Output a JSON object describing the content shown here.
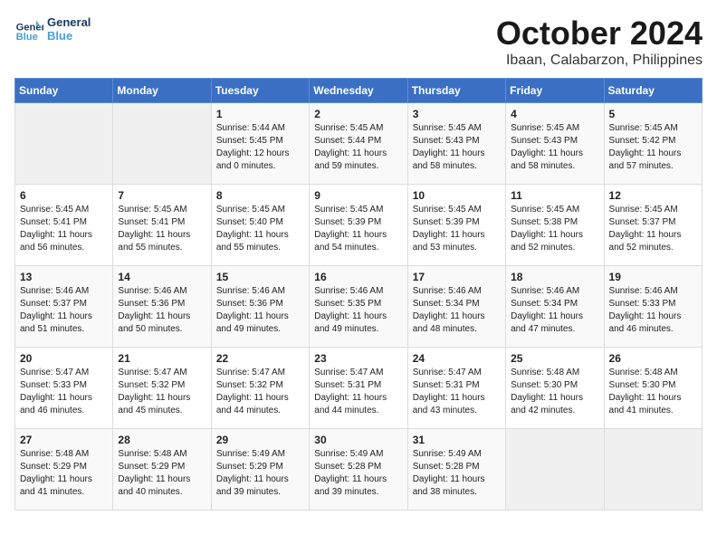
{
  "header": {
    "logo_line1": "General",
    "logo_line2": "Blue",
    "month": "October 2024",
    "location": "Ibaan, Calabarzon, Philippines"
  },
  "days_of_week": [
    "Sunday",
    "Monday",
    "Tuesday",
    "Wednesday",
    "Thursday",
    "Friday",
    "Saturday"
  ],
  "weeks": [
    [
      {
        "day": "",
        "sunrise": "",
        "sunset": "",
        "daylight": ""
      },
      {
        "day": "",
        "sunrise": "",
        "sunset": "",
        "daylight": ""
      },
      {
        "day": "1",
        "sunrise": "Sunrise: 5:44 AM",
        "sunset": "Sunset: 5:45 PM",
        "daylight": "Daylight: 12 hours and 0 minutes."
      },
      {
        "day": "2",
        "sunrise": "Sunrise: 5:45 AM",
        "sunset": "Sunset: 5:44 PM",
        "daylight": "Daylight: 11 hours and 59 minutes."
      },
      {
        "day": "3",
        "sunrise": "Sunrise: 5:45 AM",
        "sunset": "Sunset: 5:43 PM",
        "daylight": "Daylight: 11 hours and 58 minutes."
      },
      {
        "day": "4",
        "sunrise": "Sunrise: 5:45 AM",
        "sunset": "Sunset: 5:43 PM",
        "daylight": "Daylight: 11 hours and 58 minutes."
      },
      {
        "day": "5",
        "sunrise": "Sunrise: 5:45 AM",
        "sunset": "Sunset: 5:42 PM",
        "daylight": "Daylight: 11 hours and 57 minutes."
      }
    ],
    [
      {
        "day": "6",
        "sunrise": "Sunrise: 5:45 AM",
        "sunset": "Sunset: 5:41 PM",
        "daylight": "Daylight: 11 hours and 56 minutes."
      },
      {
        "day": "7",
        "sunrise": "Sunrise: 5:45 AM",
        "sunset": "Sunset: 5:41 PM",
        "daylight": "Daylight: 11 hours and 55 minutes."
      },
      {
        "day": "8",
        "sunrise": "Sunrise: 5:45 AM",
        "sunset": "Sunset: 5:40 PM",
        "daylight": "Daylight: 11 hours and 55 minutes."
      },
      {
        "day": "9",
        "sunrise": "Sunrise: 5:45 AM",
        "sunset": "Sunset: 5:39 PM",
        "daylight": "Daylight: 11 hours and 54 minutes."
      },
      {
        "day": "10",
        "sunrise": "Sunrise: 5:45 AM",
        "sunset": "Sunset: 5:39 PM",
        "daylight": "Daylight: 11 hours and 53 minutes."
      },
      {
        "day": "11",
        "sunrise": "Sunrise: 5:45 AM",
        "sunset": "Sunset: 5:38 PM",
        "daylight": "Daylight: 11 hours and 52 minutes."
      },
      {
        "day": "12",
        "sunrise": "Sunrise: 5:45 AM",
        "sunset": "Sunset: 5:37 PM",
        "daylight": "Daylight: 11 hours and 52 minutes."
      }
    ],
    [
      {
        "day": "13",
        "sunrise": "Sunrise: 5:46 AM",
        "sunset": "Sunset: 5:37 PM",
        "daylight": "Daylight: 11 hours and 51 minutes."
      },
      {
        "day": "14",
        "sunrise": "Sunrise: 5:46 AM",
        "sunset": "Sunset: 5:36 PM",
        "daylight": "Daylight: 11 hours and 50 minutes."
      },
      {
        "day": "15",
        "sunrise": "Sunrise: 5:46 AM",
        "sunset": "Sunset: 5:36 PM",
        "daylight": "Daylight: 11 hours and 49 minutes."
      },
      {
        "day": "16",
        "sunrise": "Sunrise: 5:46 AM",
        "sunset": "Sunset: 5:35 PM",
        "daylight": "Daylight: 11 hours and 49 minutes."
      },
      {
        "day": "17",
        "sunrise": "Sunrise: 5:46 AM",
        "sunset": "Sunset: 5:34 PM",
        "daylight": "Daylight: 11 hours and 48 minutes."
      },
      {
        "day": "18",
        "sunrise": "Sunrise: 5:46 AM",
        "sunset": "Sunset: 5:34 PM",
        "daylight": "Daylight: 11 hours and 47 minutes."
      },
      {
        "day": "19",
        "sunrise": "Sunrise: 5:46 AM",
        "sunset": "Sunset: 5:33 PM",
        "daylight": "Daylight: 11 hours and 46 minutes."
      }
    ],
    [
      {
        "day": "20",
        "sunrise": "Sunrise: 5:47 AM",
        "sunset": "Sunset: 5:33 PM",
        "daylight": "Daylight: 11 hours and 46 minutes."
      },
      {
        "day": "21",
        "sunrise": "Sunrise: 5:47 AM",
        "sunset": "Sunset: 5:32 PM",
        "daylight": "Daylight: 11 hours and 45 minutes."
      },
      {
        "day": "22",
        "sunrise": "Sunrise: 5:47 AM",
        "sunset": "Sunset: 5:32 PM",
        "daylight": "Daylight: 11 hours and 44 minutes."
      },
      {
        "day": "23",
        "sunrise": "Sunrise: 5:47 AM",
        "sunset": "Sunset: 5:31 PM",
        "daylight": "Daylight: 11 hours and 44 minutes."
      },
      {
        "day": "24",
        "sunrise": "Sunrise: 5:47 AM",
        "sunset": "Sunset: 5:31 PM",
        "daylight": "Daylight: 11 hours and 43 minutes."
      },
      {
        "day": "25",
        "sunrise": "Sunrise: 5:48 AM",
        "sunset": "Sunset: 5:30 PM",
        "daylight": "Daylight: 11 hours and 42 minutes."
      },
      {
        "day": "26",
        "sunrise": "Sunrise: 5:48 AM",
        "sunset": "Sunset: 5:30 PM",
        "daylight": "Daylight: 11 hours and 41 minutes."
      }
    ],
    [
      {
        "day": "27",
        "sunrise": "Sunrise: 5:48 AM",
        "sunset": "Sunset: 5:29 PM",
        "daylight": "Daylight: 11 hours and 41 minutes."
      },
      {
        "day": "28",
        "sunrise": "Sunrise: 5:48 AM",
        "sunset": "Sunset: 5:29 PM",
        "daylight": "Daylight: 11 hours and 40 minutes."
      },
      {
        "day": "29",
        "sunrise": "Sunrise: 5:49 AM",
        "sunset": "Sunset: 5:29 PM",
        "daylight": "Daylight: 11 hours and 39 minutes."
      },
      {
        "day": "30",
        "sunrise": "Sunrise: 5:49 AM",
        "sunset": "Sunset: 5:28 PM",
        "daylight": "Daylight: 11 hours and 39 minutes."
      },
      {
        "day": "31",
        "sunrise": "Sunrise: 5:49 AM",
        "sunset": "Sunset: 5:28 PM",
        "daylight": "Daylight: 11 hours and 38 minutes."
      },
      {
        "day": "",
        "sunrise": "",
        "sunset": "",
        "daylight": ""
      },
      {
        "day": "",
        "sunrise": "",
        "sunset": "",
        "daylight": ""
      }
    ]
  ]
}
